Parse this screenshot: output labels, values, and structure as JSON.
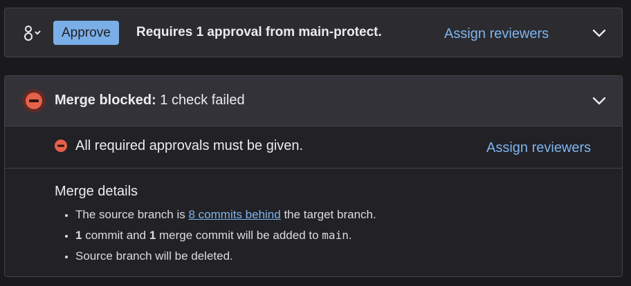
{
  "approval": {
    "approve_label": "Approve",
    "requirement_text": "Requires 1 approval from main-protect.",
    "assign_reviewers_label": "Assign reviewers",
    "icon": "approvers-icon"
  },
  "merge": {
    "status_label": "Merge blocked:",
    "status_detail": "1 check failed",
    "check_text": "All required approvals must be given.",
    "check_assign_label": "Assign reviewers",
    "details_title": "Merge details",
    "details": {
      "item1_prefix": "The source branch is",
      "item1_link": "8 commits behind",
      "item1_suffix": "the target branch.",
      "item2_count1": "1",
      "item2_mid": "commit and",
      "item2_count2": "1",
      "item2_after": "merge commit will be added to",
      "item2_branch": "main",
      "item2_end": ".",
      "item3": "Source branch will be deleted."
    }
  },
  "colors": {
    "approve_button": "#7aaee6",
    "link": "#7eb5ee",
    "danger": "#e5614a",
    "panel": "#333238",
    "background": "#1a1a1d"
  }
}
